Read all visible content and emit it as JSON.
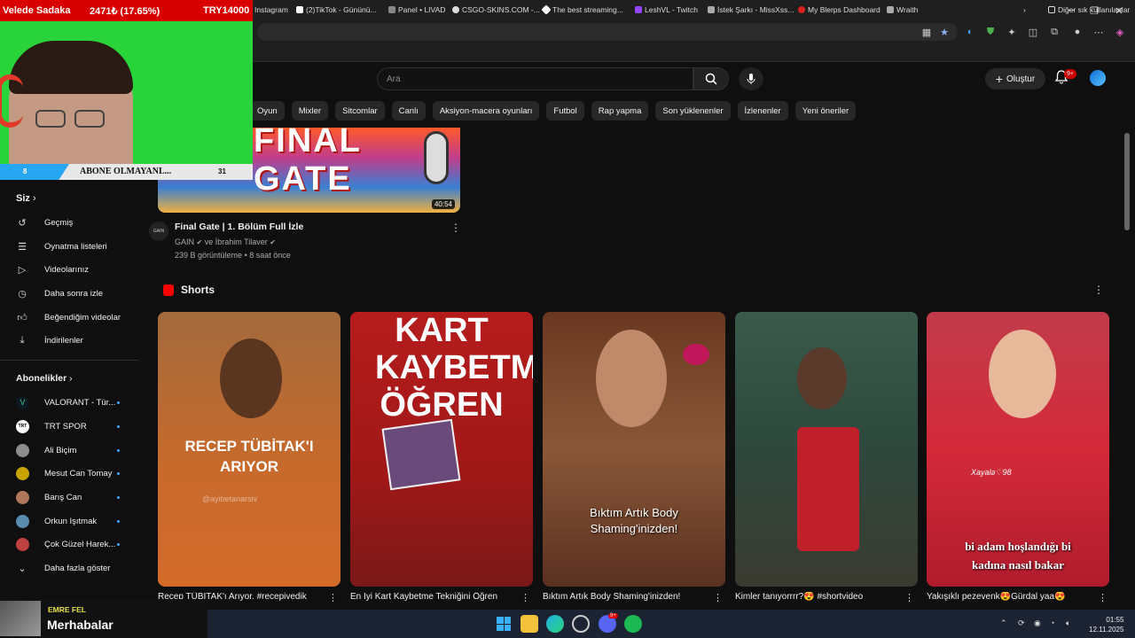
{
  "stream": {
    "donation_name": "Velede Sadaka",
    "donation_amount": "2471₺ (17.65%)",
    "donation_goal": "TRY14000",
    "subs_text": "ABONE OLMAYANL...",
    "subs_left": "8",
    "subs_right": "31",
    "chat_user": "EMRE FEL",
    "chat_message": "Merhabalar"
  },
  "bookmarks": [
    "Instagram",
    "(2)TikTok - Gününü...",
    "Panel • LIVAD",
    "CSGO-SKINS.COM -...",
    "The best streaming...",
    "LeshVL - Twitch",
    "İstek Şarkı - MissXss...",
    "My Blerps Dashboard",
    "Wraith",
    "Diğer sık kullanılanlar"
  ],
  "header": {
    "search_placeholder": "Ara",
    "create_label": "Oluştur",
    "notif_count": "9+"
  },
  "chips": [
    "Oyun",
    "Mixler",
    "Sitcomlar",
    "Canlı",
    "Aksiyon-macera oyunları",
    "Futbol",
    "Rap yapma",
    "Son yüklenenler",
    "İzlenenler",
    "Yeni öneriler"
  ],
  "sidebar": {
    "you_label": "Siz",
    "you_items": [
      "Geçmiş",
      "Oynatma listeleri",
      "Videolarınız",
      "Daha sonra izle",
      "Beğendiğim videolar",
      "İndirilenler"
    ],
    "subs_label": "Abonelikler",
    "subs": [
      {
        "name": "VALORANT - Tür...",
        "color": "#0f1923"
      },
      {
        "name": "TRT SPOR",
        "color": "#ffffff"
      },
      {
        "name": "Ali Biçim",
        "color": "#8d8d8d"
      },
      {
        "name": "Mesut Can Tomay",
        "color": "#c8a400"
      },
      {
        "name": "Barış Can",
        "color": "#b0785a"
      },
      {
        "name": "Orkun Işıtmak",
        "color": "#5a8cb0"
      },
      {
        "name": "Çok Güzel Harek...",
        "color": "#c04040"
      }
    ],
    "show_more": "Daha fazla göster"
  },
  "top_video": {
    "thumb_text": "FINAL GATE",
    "duration": "40:54",
    "channel_logo": "GAIN",
    "title": "Final Gate | 1. Bölüm Full İzle",
    "channel": "GAIN",
    "with_text": "ve İbrahim Tilaver",
    "meta": "239 B görüntüleme • 8 saat önce"
  },
  "shorts": {
    "heading": "Shorts",
    "items": [
      {
        "caption": "RECEP TÜBİTAK'I ARIYOR",
        "watermark": "@ayibetanarsiv",
        "title": "Recep TÜBİTAK'ı Arıyor. #recepivedik"
      },
      {
        "caption": "KART KAYBETME ÖĞREN",
        "title": "En İyi Kart Kaybetme Tekniğini Öğren"
      },
      {
        "caption": "Bıktım Artık Body Shaming'inizden!",
        "title": "Bıktım Artık Body Shaming'inizden!"
      },
      {
        "caption": "",
        "title": "Kimler tanıyorrrr?😍 #shortvideo"
      },
      {
        "caption": "bi adam hoşlandığı bi kadına nasıl bakar",
        "watermark": "Xayalə♡98",
        "title": "Yakışıklı pezevenk😍Gürdal yaa😍"
      }
    ]
  },
  "taskbar": {
    "time": "01:55",
    "date": "12.11.2025",
    "discord_badge": "9+"
  }
}
